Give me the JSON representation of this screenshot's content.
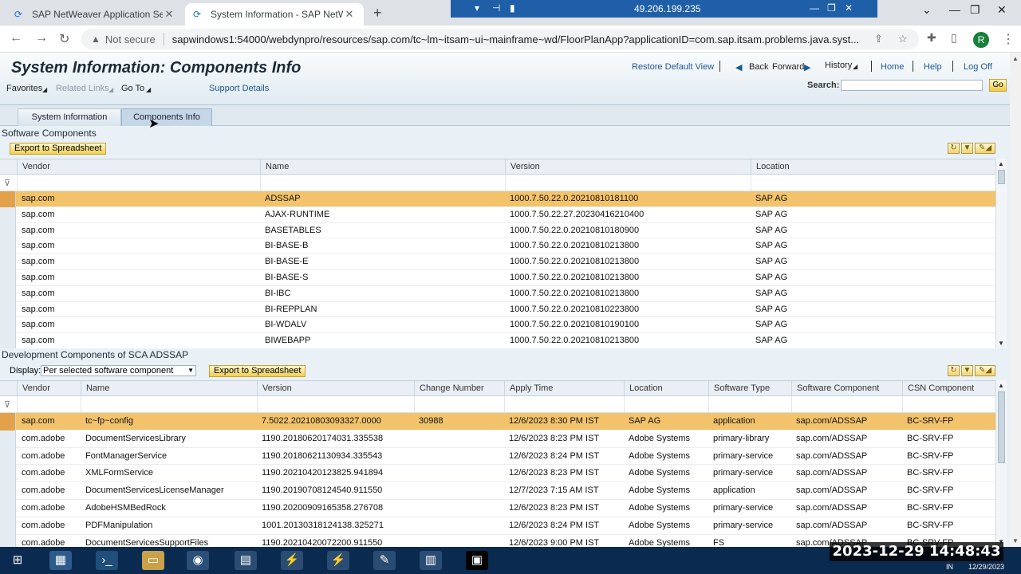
{
  "browser": {
    "tabs": [
      {
        "title": "SAP NetWeaver Application Serv",
        "active": false
      },
      {
        "title": "System Information - SAP NetW",
        "active": true
      }
    ],
    "remote_ip": "49.206.199.235",
    "not_secure": "Not secure",
    "url": "sapwindows1:54000/webdynpro/resources/sap.com/tc~lm~itsam~ui~mainframe~wd/FloorPlanApp?applicationID=com.sap.itsam.problems.java.syst...",
    "avatar_letter": "R"
  },
  "sap": {
    "title": "System Information: Components Info",
    "header_links": {
      "restore": "Restore Default View",
      "back": "Back",
      "forward": "Forward",
      "history": "History",
      "home": "Home",
      "help": "Help",
      "logoff": "Log Off"
    },
    "menu": {
      "favorites": "Favorites",
      "related": "Related Links",
      "goto": "Go To",
      "support": "Support Details"
    },
    "search_label": "Search:",
    "go_label": "Go",
    "subtabs": [
      "System Information",
      "Components Info"
    ],
    "software": {
      "title": "Software Components",
      "export": "Export to Spreadsheet",
      "columns": [
        "Vendor",
        "Name",
        "Version",
        "Location"
      ],
      "rows": [
        [
          "sap.com",
          "ADSSAP",
          "1000.7.50.22.0.20210810181100",
          "SAP AG"
        ],
        [
          "sap.com",
          "AJAX-RUNTIME",
          "1000.7.50.22.27.20230416210400",
          "SAP AG"
        ],
        [
          "sap.com",
          "BASETABLES",
          "1000.7.50.22.0.20210810180900",
          "SAP AG"
        ],
        [
          "sap.com",
          "BI-BASE-B",
          "1000.7.50.22.0.20210810213800",
          "SAP AG"
        ],
        [
          "sap.com",
          "BI-BASE-E",
          "1000.7.50.22.0.20210810213800",
          "SAP AG"
        ],
        [
          "sap.com",
          "BI-BASE-S",
          "1000.7.50.22.0.20210810213800",
          "SAP AG"
        ],
        [
          "sap.com",
          "BI-IBC",
          "1000.7.50.22.0.20210810213800",
          "SAP AG"
        ],
        [
          "sap.com",
          "BI-REPPLAN",
          "1000.7.50.22.0.20210810223800",
          "SAP AG"
        ],
        [
          "sap.com",
          "BI-WDALV",
          "1000.7.50.22.0.20210810190100",
          "SAP AG"
        ],
        [
          "sap.com",
          "BIWEBAPP",
          "1000.7.50.22.0.20210810213800",
          "SAP AG"
        ]
      ]
    },
    "development": {
      "title": "Development Components of SCA ADSSAP",
      "display_label": "Display:",
      "display_value": "Per selected software component",
      "export": "Export to Spreadsheet",
      "columns": [
        "Vendor",
        "Name",
        "Version",
        "Change Number",
        "Apply Time",
        "Location",
        "Software Type",
        "Software Component",
        "CSN Component"
      ],
      "rows": [
        [
          "sap.com",
          "tc~fp~config",
          "7.5022.20210803093327.0000",
          "30988",
          "12/6/2023 8:30 PM IST",
          "SAP AG",
          "application",
          "sap.com/ADSSAP",
          "BC-SRV-FP"
        ],
        [
          "com.adobe",
          "DocumentServicesLibrary",
          "1190.20180620174031.335538",
          "",
          "12/6/2023 8:23 PM IST",
          "Adobe Systems",
          "primary-library",
          "sap.com/ADSSAP",
          "BC-SRV-FP"
        ],
        [
          "com.adobe",
          "FontManagerService",
          "1190.20180621130934.335543",
          "",
          "12/6/2023 8:24 PM IST",
          "Adobe Systems",
          "primary-service",
          "sap.com/ADSSAP",
          "BC-SRV-FP"
        ],
        [
          "com.adobe",
          "XMLFormService",
          "1190.20210420123825.941894",
          "",
          "12/6/2023 8:23 PM IST",
          "Adobe Systems",
          "primary-service",
          "sap.com/ADSSAP",
          "BC-SRV-FP"
        ],
        [
          "com.adobe",
          "DocumentServicesLicenseManager",
          "1190.20190708124540.911550",
          "",
          "12/7/2023 7:15 AM IST",
          "Adobe Systems",
          "application",
          "sap.com/ADSSAP",
          "BC-SRV-FP"
        ],
        [
          "com.adobe",
          "AdobeHSMBedRock",
          "1190.20200909165358.276708",
          "",
          "12/6/2023 8:23 PM IST",
          "Adobe Systems",
          "primary-service",
          "sap.com/ADSSAP",
          "BC-SRV-FP"
        ],
        [
          "com.adobe",
          "PDFManipulation",
          "1001.20130318124138.325271",
          "",
          "12/6/2023 8:24 PM IST",
          "Adobe Systems",
          "primary-service",
          "sap.com/ADSSAP",
          "BC-SRV-FP"
        ],
        [
          "com.adobe",
          "DocumentServicesSupportFiles",
          "1190.20210420072200.911550",
          "",
          "12/6/2023 9:00 PM IST",
          "Adobe Systems",
          "FS",
          "sap.com/ADSSAP",
          "BC-SRV-FP"
        ]
      ]
    }
  },
  "taskbar": {
    "clock": "2023-12-29 14:48:43",
    "lang": "IN",
    "date": "12/29/2023"
  },
  "colors": {
    "selected_row": "#f2c36b",
    "sap_bg": "#eaf1f6",
    "taskbar": "#0b2a4f"
  }
}
